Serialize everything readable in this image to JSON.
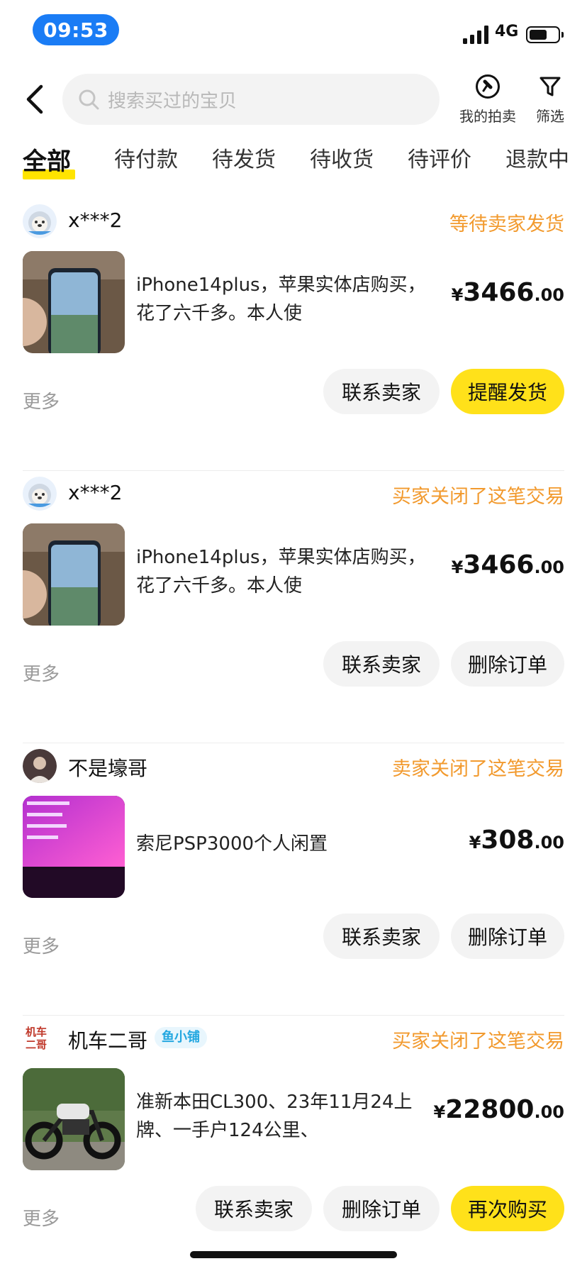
{
  "status_bar": {
    "time": "09:53",
    "network": "4G"
  },
  "header": {
    "search_placeholder": "搜索买过的宝贝",
    "auction_label": "我的拍卖",
    "filter_label": "筛选"
  },
  "tabs": [
    {
      "label": "全部",
      "active": true
    },
    {
      "label": "待付款"
    },
    {
      "label": "待发货"
    },
    {
      "label": "待收货"
    },
    {
      "label": "待评价"
    },
    {
      "label": "退款中"
    }
  ],
  "colors": {
    "accent_yellow": "#ffe11a",
    "status_orange": "#f29a2e",
    "time_pill_blue": "#1a7cf5",
    "tag_blue": "#23a7e0"
  },
  "orders": [
    {
      "seller": "x***2",
      "status": "等待卖家发货",
      "title": "iPhone14plus，苹果实体店购买，花了六千多。本人使",
      "price_symbol": "¥",
      "price_integer": "3466",
      "price_decimal": ".00",
      "more": "更多",
      "buttons": [
        "联系卖家",
        "提醒发货"
      ]
    },
    {
      "seller": "x***2",
      "status": "买家关闭了这笔交易",
      "title": "iPhone14plus，苹果实体店购买，花了六千多。本人使",
      "price_symbol": "¥",
      "price_integer": "3466",
      "price_decimal": ".00",
      "more": "更多",
      "buttons": [
        "联系卖家",
        "删除订单"
      ]
    },
    {
      "seller": "不是壕哥",
      "status": "卖家关闭了这笔交易",
      "title": "索尼PSP3000个人闲置",
      "price_symbol": "¥",
      "price_integer": "308",
      "price_decimal": ".00",
      "more": "更多",
      "buttons": [
        "联系卖家",
        "删除订单"
      ]
    },
    {
      "seller": "机车二哥",
      "seller_avatar_text": "机车二哥",
      "shop_tag": "鱼小铺",
      "status": "买家关闭了这笔交易",
      "title": "准新本田CL300、23年11月24上牌、一手户124公里、",
      "price_symbol": "¥",
      "price_integer": "22800",
      "price_decimal": ".00",
      "more": "更多",
      "buttons": [
        "联系卖家",
        "删除订单",
        "再次购买"
      ]
    }
  ]
}
